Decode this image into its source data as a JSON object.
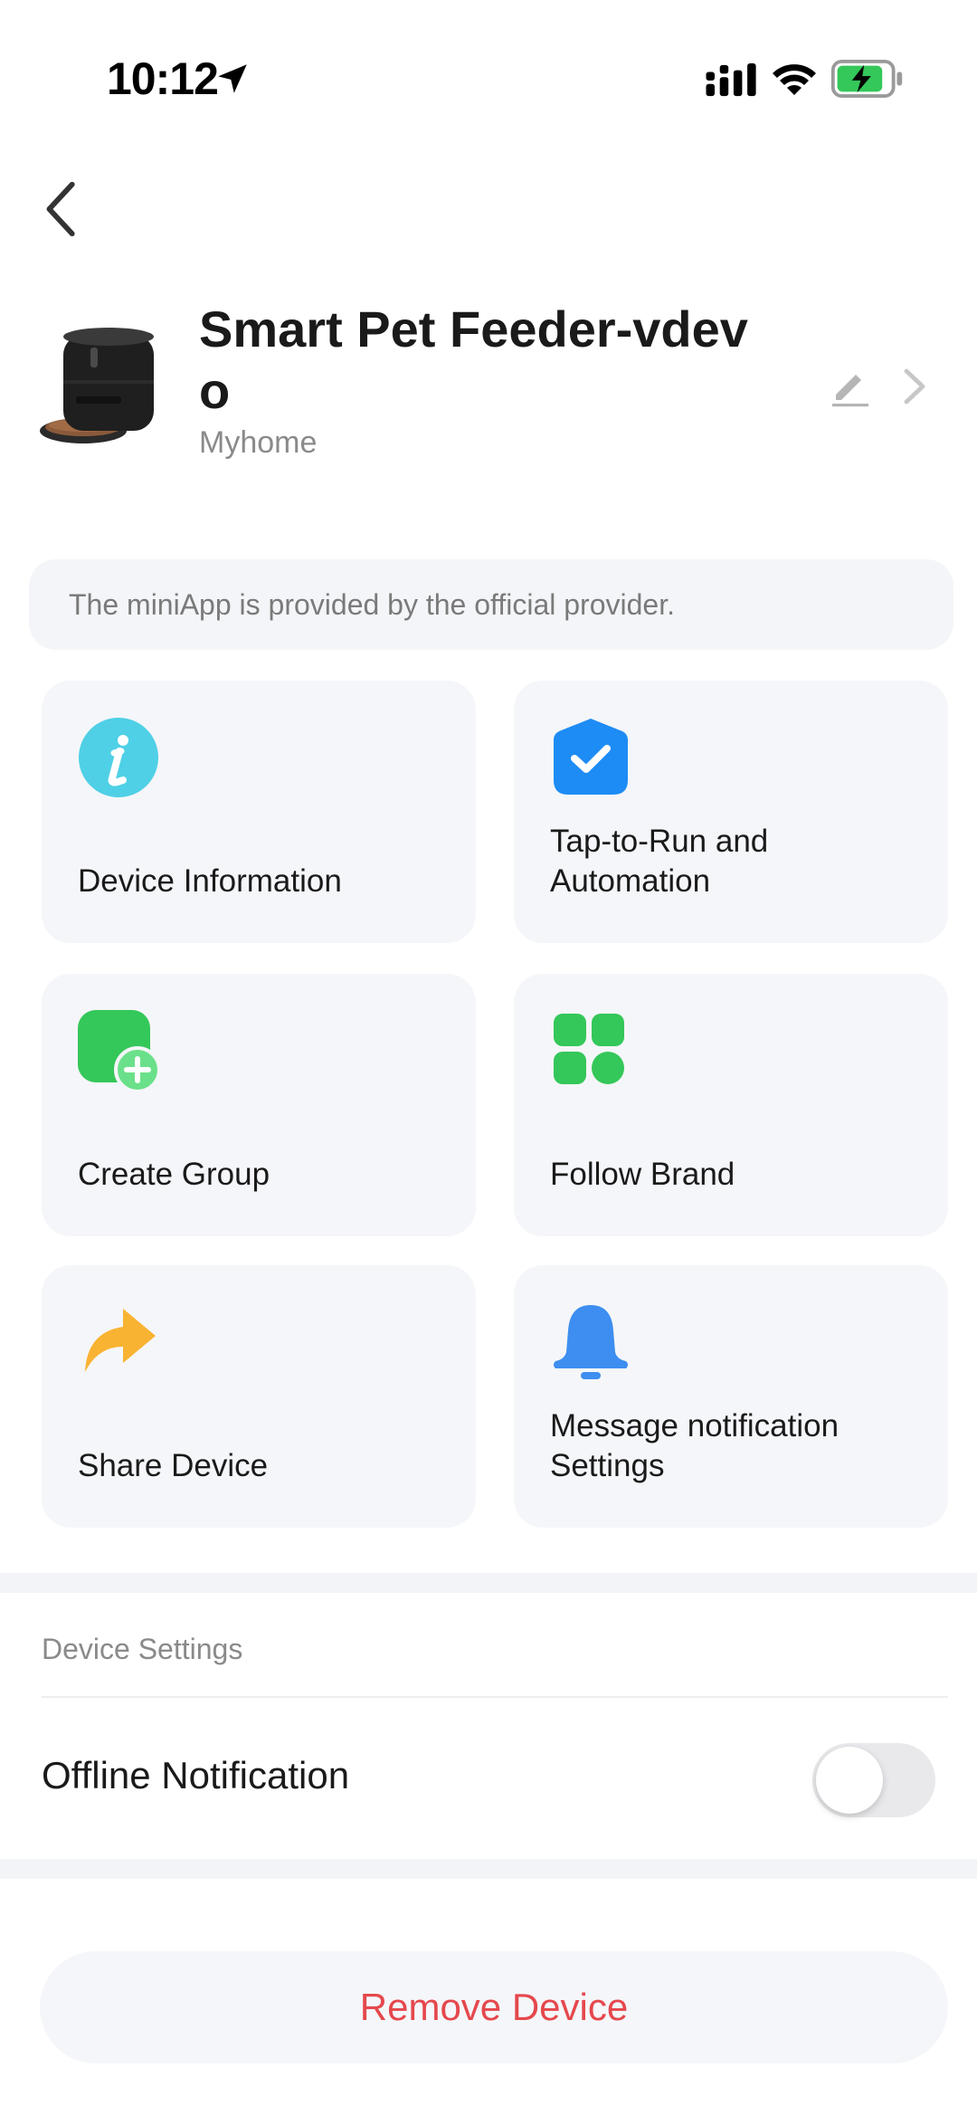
{
  "status_bar": {
    "time": "10:12"
  },
  "device": {
    "name": "Smart Pet Feeder-vdevo",
    "room": "Myhome"
  },
  "notice": {
    "text": "The miniApp is provided by the official provider."
  },
  "grid": {
    "items": [
      {
        "label": "Device Information",
        "icon": "info-icon",
        "color": "#4fd0e6"
      },
      {
        "label": "Tap-to-Run and Automation",
        "icon": "check-badge-icon",
        "color": "#1e8cf5"
      },
      {
        "label": "Create Group",
        "icon": "create-group-icon",
        "color": "#34c759"
      },
      {
        "label": "Follow Brand",
        "icon": "grid-icon",
        "color": "#34c759"
      },
      {
        "label": "Share Device",
        "icon": "share-arrow-icon",
        "color": "#f9b332"
      },
      {
        "label": "Message notification Settings",
        "icon": "bell-icon",
        "color": "#3d8ef0"
      }
    ]
  },
  "settings": {
    "section_title": "Device Settings",
    "offline_notification": {
      "label": "Offline Notification",
      "enabled": false
    }
  },
  "actions": {
    "remove_label": "Remove Device",
    "remove_color": "#e5484d"
  }
}
